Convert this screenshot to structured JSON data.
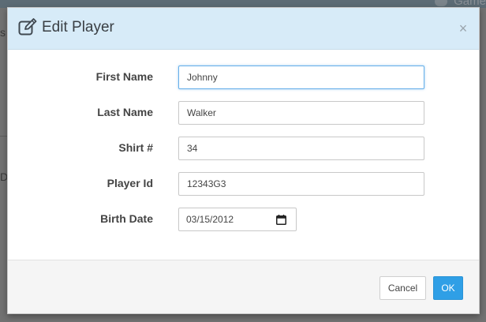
{
  "background": {
    "games_label": "Game",
    "left_text_top": "s",
    "left_text_mid": "D"
  },
  "modal": {
    "title": "Edit Player",
    "close_symbol": "×",
    "icon": "edit-icon"
  },
  "form": {
    "first_name": {
      "label": "First Name",
      "value": "Johnny"
    },
    "last_name": {
      "label": "Last Name",
      "value": "Walker"
    },
    "shirt": {
      "label": "Shirt #",
      "value": "34"
    },
    "player_id": {
      "label": "Player Id",
      "value": "12343G3"
    },
    "birth_date": {
      "label": "Birth Date",
      "value": "03/15/2012",
      "icon": "calendar-icon"
    }
  },
  "footer": {
    "cancel_label": "Cancel",
    "ok_label": "OK"
  },
  "colors": {
    "header_bg": "#d7ebf8",
    "ok_button": "#2f9fe6",
    "focus_border": "#66afe9"
  }
}
